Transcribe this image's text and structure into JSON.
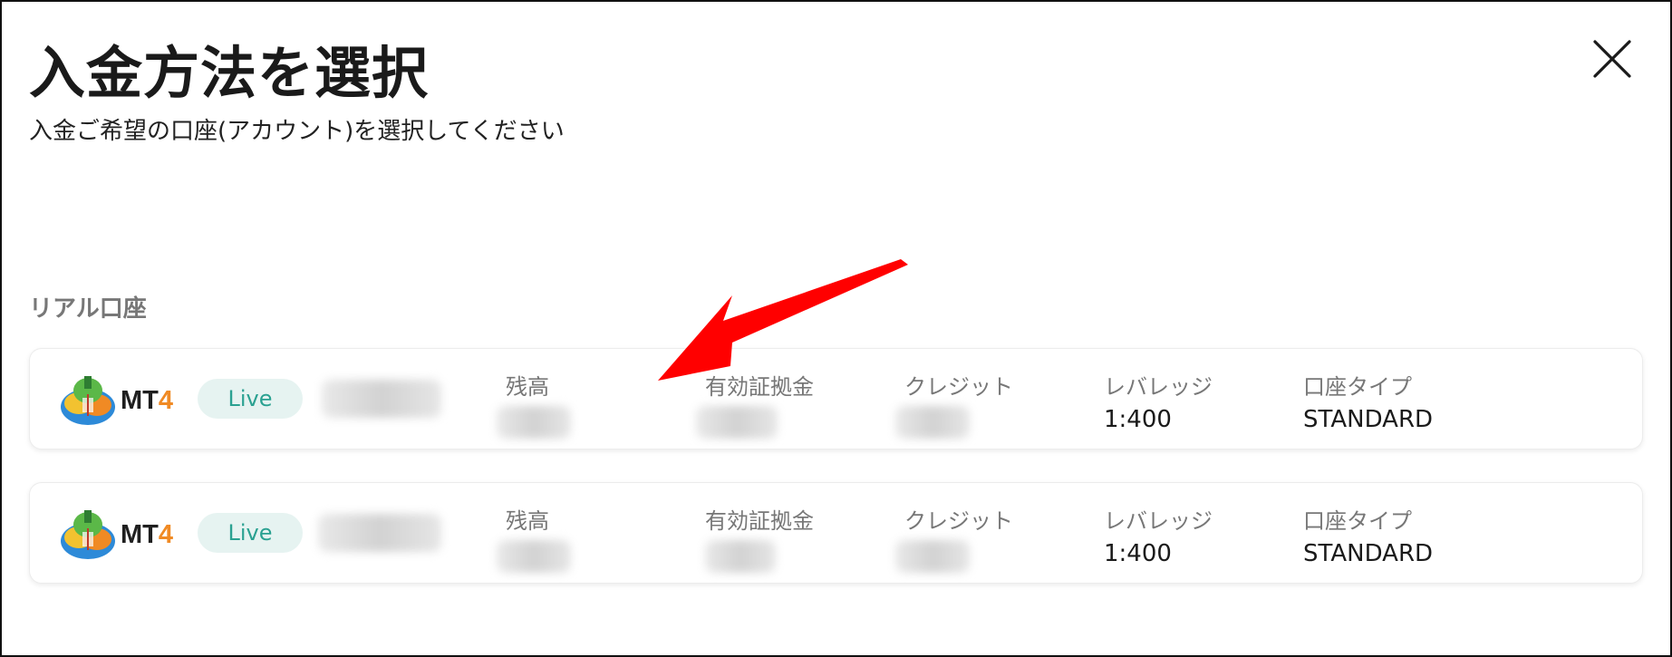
{
  "dialog": {
    "title": "入金方法を選択",
    "subtitle": "入金ご希望の口座(アカウント)を選択してください",
    "close_icon": "close-icon"
  },
  "section": {
    "label": "リアル口座"
  },
  "accounts": [
    {
      "platform": "MT",
      "platform_version": "4",
      "status": "Live",
      "balance_label": "残高",
      "equity_label": "有効証拠金",
      "credit_label": "クレジット",
      "leverage_label": "レバレッジ",
      "leverage_value": "1:400",
      "type_label": "口座タイプ",
      "type_value": "STANDARD"
    },
    {
      "platform": "MT",
      "platform_version": "4",
      "status": "Live",
      "balance_label": "残高",
      "equity_label": "有効証拠金",
      "credit_label": "クレジット",
      "leverage_label": "レバレッジ",
      "leverage_value": "1:400",
      "type_label": "口座タイプ",
      "type_value": "STANDARD"
    }
  ],
  "colors": {
    "live_badge_bg": "#e6f3f1",
    "live_badge_text": "#2aa191",
    "mt4_accent": "#f08a24",
    "annotation_arrow": "#ff0000"
  }
}
